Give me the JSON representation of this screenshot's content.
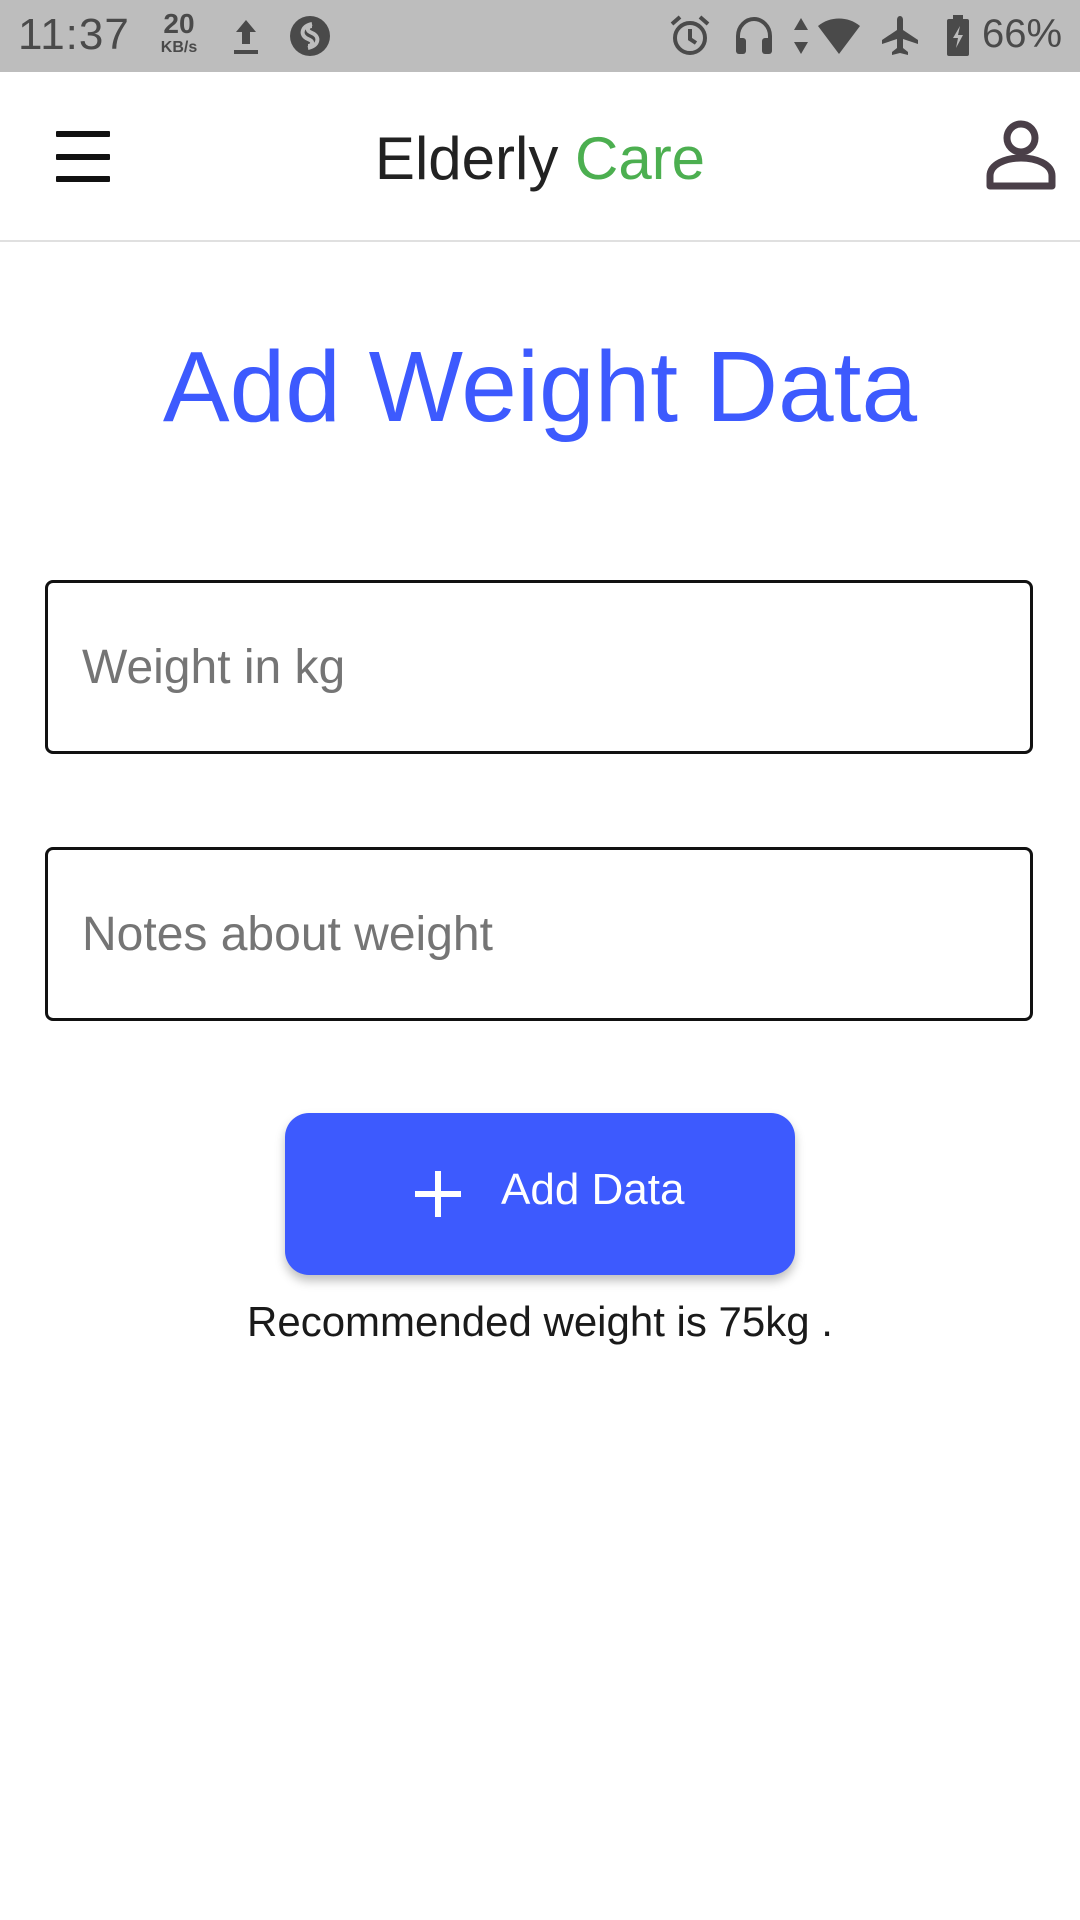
{
  "status_bar": {
    "time": "11:37",
    "net_speed_value": "20",
    "net_speed_unit": "KB/s",
    "battery": "66%",
    "icons": [
      "upload-icon",
      "shazam-icon",
      "alarm-icon",
      "headset-icon",
      "data-arrows-icon",
      "wifi-icon",
      "airplane-icon",
      "battery-icon"
    ]
  },
  "app_bar": {
    "title_main": "Elderly",
    "title_accent": "Care",
    "accent_color": "#4caf50",
    "menu_icon": "hamburger-menu-icon",
    "profile_icon": "person-icon"
  },
  "page": {
    "title": "Add Weight Data",
    "title_color": "#3d5afe",
    "weight_field": {
      "placeholder": "Weight in kg",
      "value": ""
    },
    "notes_field": {
      "placeholder": "Notes about weight",
      "value": ""
    },
    "add_button": {
      "label": "Add Data",
      "icon": "plus-icon",
      "color": "#3d5afe"
    },
    "recommendation": "Recommended weight is 75kg ."
  }
}
